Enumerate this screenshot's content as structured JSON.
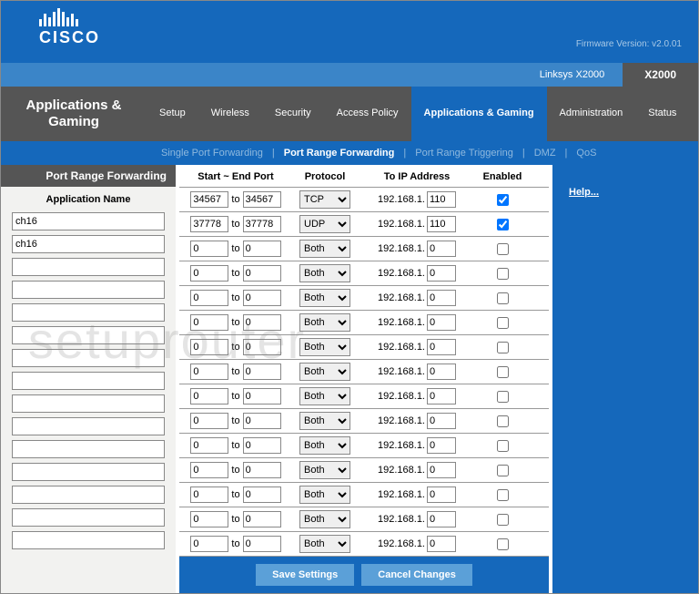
{
  "header": {
    "brand": "CISCO",
    "firmware": "Firmware Version: v2.0.01"
  },
  "models": {
    "link": "Linksys X2000",
    "active": "X2000"
  },
  "nav": {
    "title": "Applications & Gaming",
    "tabs": [
      "Setup",
      "Wireless",
      "Security",
      "Access Policy",
      "Applications & Gaming",
      "Administration",
      "Status"
    ],
    "active_index": 4
  },
  "subnav": {
    "items": [
      "Single Port Forwarding",
      "Port Range Forwarding",
      "Port Range Triggering",
      "DMZ",
      "QoS"
    ],
    "active_index": 1
  },
  "section": {
    "title": "Port Range Forwarding",
    "subtitle": "Application Name"
  },
  "table": {
    "headers": {
      "port": "Start ~ End Port",
      "proto": "Protocol",
      "ip": "To IP Address",
      "enabled": "Enabled"
    },
    "to_label": "to",
    "ip_prefix": "192.168.1.",
    "protocol_options": [
      "Both",
      "TCP",
      "UDP"
    ],
    "rows": [
      {
        "app": "ch16",
        "start": "34567",
        "end": "34567",
        "protocol": "TCP",
        "ip": "110",
        "enabled": true
      },
      {
        "app": "ch16",
        "start": "37778",
        "end": "37778",
        "protocol": "UDP",
        "ip": "110",
        "enabled": true
      },
      {
        "app": "",
        "start": "0",
        "end": "0",
        "protocol": "Both",
        "ip": "0",
        "enabled": false
      },
      {
        "app": "",
        "start": "0",
        "end": "0",
        "protocol": "Both",
        "ip": "0",
        "enabled": false
      },
      {
        "app": "",
        "start": "0",
        "end": "0",
        "protocol": "Both",
        "ip": "0",
        "enabled": false
      },
      {
        "app": "",
        "start": "0",
        "end": "0",
        "protocol": "Both",
        "ip": "0",
        "enabled": false
      },
      {
        "app": "",
        "start": "0",
        "end": "0",
        "protocol": "Both",
        "ip": "0",
        "enabled": false
      },
      {
        "app": "",
        "start": "0",
        "end": "0",
        "protocol": "Both",
        "ip": "0",
        "enabled": false
      },
      {
        "app": "",
        "start": "0",
        "end": "0",
        "protocol": "Both",
        "ip": "0",
        "enabled": false
      },
      {
        "app": "",
        "start": "0",
        "end": "0",
        "protocol": "Both",
        "ip": "0",
        "enabled": false
      },
      {
        "app": "",
        "start": "0",
        "end": "0",
        "protocol": "Both",
        "ip": "0",
        "enabled": false
      },
      {
        "app": "",
        "start": "0",
        "end": "0",
        "protocol": "Both",
        "ip": "0",
        "enabled": false
      },
      {
        "app": "",
        "start": "0",
        "end": "0",
        "protocol": "Both",
        "ip": "0",
        "enabled": false
      },
      {
        "app": "",
        "start": "0",
        "end": "0",
        "protocol": "Both",
        "ip": "0",
        "enabled": false
      },
      {
        "app": "",
        "start": "0",
        "end": "0",
        "protocol": "Both",
        "ip": "0",
        "enabled": false
      }
    ]
  },
  "help": {
    "label": "Help..."
  },
  "buttons": {
    "save": "Save Settings",
    "cancel": "Cancel Changes"
  },
  "watermark": "setuprouter"
}
